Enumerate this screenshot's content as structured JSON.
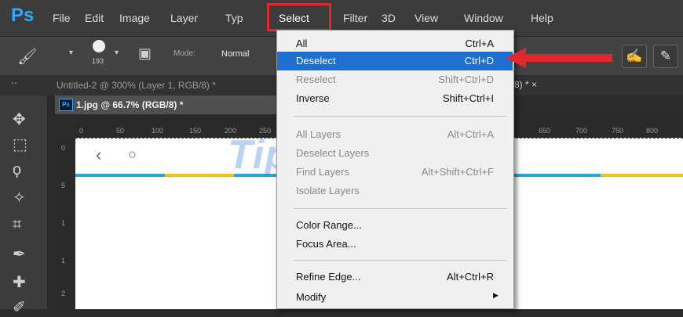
{
  "app": {
    "logo": "Ps",
    "menus": [
      "File",
      "Edit",
      "Image",
      "Layer",
      "Typ",
      "Select",
      "Filter",
      "3D",
      "View",
      "Window",
      "Help"
    ]
  },
  "options_bar": {
    "brush_size": "193",
    "mode_label": "Mode:",
    "mode_value": "Normal"
  },
  "tabs": {
    "background_tab": "Untitled-2 @ 300% (Layer 1, RGB/8) *",
    "background_tab_tail": "8) * ×",
    "active_tab": "1.jpg @ 66.7% (RGB/8) *",
    "active_badge": "Ps"
  },
  "ruler": {
    "top_ticks": [
      "0",
      "50",
      "100",
      "150",
      "200",
      "250",
      "650",
      "700",
      "750",
      "800"
    ],
    "left_ticks": [
      "0",
      "5",
      "1",
      "1",
      "2"
    ]
  },
  "watermark": "TipsMake",
  "dropdown": {
    "items": [
      {
        "label": "All",
        "shortcut": "Ctrl+A",
        "state": "enabled"
      },
      {
        "label": "Deselect",
        "shortcut": "Ctrl+D",
        "state": "highlighted"
      },
      {
        "label": "Reselect",
        "shortcut": "Shift+Ctrl+D",
        "state": "disabled"
      },
      {
        "label": "Inverse",
        "shortcut": "Shift+Ctrl+I",
        "state": "enabled"
      },
      {
        "label": "All Layers",
        "shortcut": "Alt+Ctrl+A",
        "state": "disabled"
      },
      {
        "label": "Deselect Layers",
        "shortcut": "",
        "state": "disabled"
      },
      {
        "label": "Find Layers",
        "shortcut": "Alt+Shift+Ctrl+F",
        "state": "disabled"
      },
      {
        "label": "Isolate Layers",
        "shortcut": "",
        "state": "disabled"
      },
      {
        "label": "Color Range...",
        "shortcut": "",
        "state": "enabled"
      },
      {
        "label": "Focus Area...",
        "shortcut": "",
        "state": "enabled"
      },
      {
        "label": "Refine Edge...",
        "shortcut": "Alt+Ctrl+R",
        "state": "enabled"
      },
      {
        "label": "Modify",
        "shortcut": "",
        "state": "enabled"
      }
    ]
  },
  "colors": {
    "highlight": "#1e6fd0",
    "annotation_red": "#e0282c",
    "ps_blue": "#31a8ff"
  }
}
